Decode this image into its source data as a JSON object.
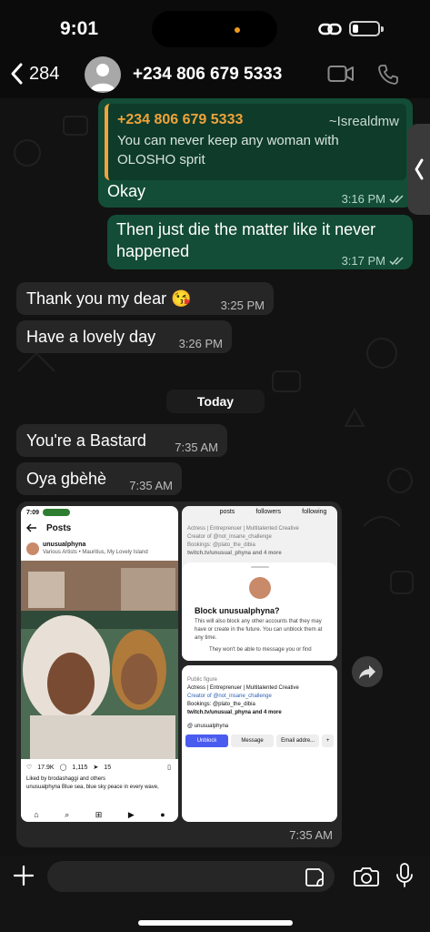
{
  "status_bar": {
    "time": "9:01"
  },
  "header": {
    "back_count": "284",
    "contact_name": "+234 806 679 5333"
  },
  "messages": {
    "m1": {
      "quote_author": "+234 806 679 5333",
      "quote_alias": "~Isrealdmw",
      "quote_text": "You can never keep any woman with OLOSHO sprit",
      "text": "Okay",
      "time": "3:16 PM"
    },
    "m2": {
      "text": "Then just die the matter like it never happened",
      "time": "3:17 PM"
    },
    "m3": {
      "text": "Thank you my dear 😘",
      "time": "3:25 PM"
    },
    "m4": {
      "text": "Have a lovely day",
      "time": "3:26 PM"
    },
    "date_divider": "Today",
    "m5": {
      "text": "You're a Bastard",
      "time": "7:35 AM"
    },
    "m6": {
      "text": "Oya gbèhè",
      "time": "7:35 AM"
    },
    "media": {
      "time": "7:35 AM",
      "left": {
        "status_time": "7:09",
        "title": "Posts",
        "username": "unusualphyna",
        "song": "Various Artists • Mauritius, My Lovely Island",
        "likes": "17.9K",
        "comments": "1,115",
        "shares": "15",
        "liked_by": "Liked by brodashaggi and others",
        "caption": "unusualphyna Blue sea, blue sky peace in every wave,"
      },
      "right_top": {
        "stats": [
          "posts",
          "followers",
          "following"
        ],
        "bio1": "Actress | Entreprenuer | Multitalented Creative",
        "bio2": "Creator of @not_insane_challenge",
        "bio3": "Bookings: @plato_the_dibia",
        "link": "twitch.tv/unusual_phyna and 4 more",
        "sheet_title": "Block unusualphyna?",
        "sheet_text": "This will also block any other accounts that they may have or create in the future. You can unblock them at any time.",
        "sheet_note": "They won't be able to message you or find"
      },
      "right_bottom": {
        "category": "Public figure",
        "bio1": "Actress | Entreprenuer | Multitalented Creative",
        "bio2": "Creator of @not_insane_challenge",
        "bio3": "Bookings: @plato_the_dibia",
        "link": "twitch.tv/unusual_phyna and 4 more",
        "threads": "unusualphyna",
        "btn_unblock": "Unblock",
        "btn_message": "Message",
        "btn_email": "Email addre..."
      }
    }
  },
  "colors": {
    "outgoing_bubble": "#134d37",
    "incoming_bubble": "#262626",
    "quote_accent": "#f0a33a",
    "read_receipt": "#b6d6c6"
  }
}
